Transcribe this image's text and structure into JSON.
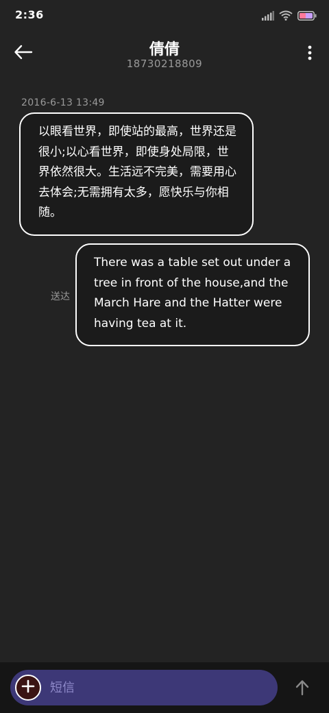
{
  "status_bar": {
    "time": "2:36",
    "icons": [
      "signal-icon",
      "wifi-icon",
      "battery-icon"
    ],
    "battery_color": "#c9a0ff"
  },
  "header": {
    "contact_name": "倩倩",
    "contact_number": "18730218809",
    "back_icon": "back-arrow-icon",
    "more_icon": "more-vertical-icon"
  },
  "conversation": {
    "timestamp": "2016-6-13 13:49",
    "messages": [
      {
        "direction": "incoming",
        "text": "以眼看世界，即使站的最高，世界还是很小;以心看世界，即使身处局限，世界依然很大。生活远不完美，需要用心去体会;无需拥有太多，愿快乐与你相随。"
      },
      {
        "direction": "outgoing",
        "text": "There was a table set out under a tree in front of the house,and the March Hare and the Hatter were having tea at it.",
        "status": "送达"
      }
    ]
  },
  "composer": {
    "placeholder": "短信",
    "value": "",
    "add_icon": "plus-icon",
    "send_icon": "send-arrow-icon",
    "field_color": "#3d3877",
    "add_button_color": "#3b1414"
  }
}
